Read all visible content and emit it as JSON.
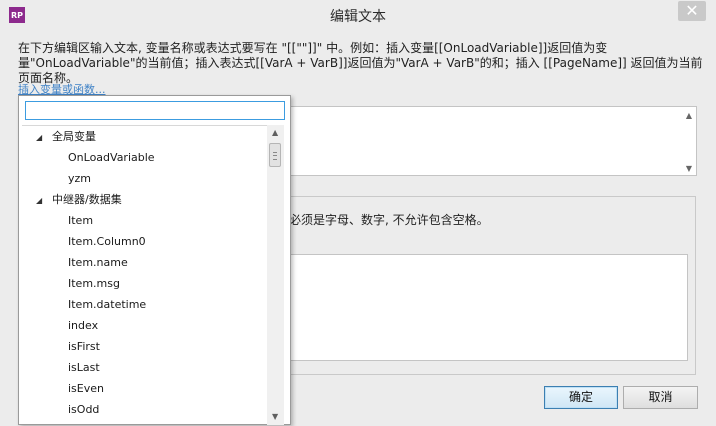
{
  "window": {
    "title": "编辑文本",
    "app_icon_text": "RP",
    "close_glyph": "✕"
  },
  "description": "在下方编辑区输入文本, 变量名称或表达式要写在 \"[[\"\"]]\" 中。例如：插入变量[[OnLoadVariable]]返回值为变量\"OnLoadVariable\"的当前值；插入表达式[[VarA + VarB]]返回值为\"VarA + VarB\"的和；插入 [[PageName]] 返回值为当前页面名称。",
  "insert_link": "插入变量或函数...",
  "group_text": "必须是字母、数字, 不允许包含空格。",
  "buttons": {
    "ok": "确定",
    "cancel": "取消"
  },
  "popup": {
    "search_value": "",
    "tree": [
      {
        "type": "group",
        "label": "全局变量"
      },
      {
        "type": "leaf",
        "label": "OnLoadVariable"
      },
      {
        "type": "leaf",
        "label": "yzm"
      },
      {
        "type": "group",
        "label": "中继器/数据集"
      },
      {
        "type": "leaf",
        "label": "Item"
      },
      {
        "type": "leaf",
        "label": "Item.Column0"
      },
      {
        "type": "leaf",
        "label": "Item.name"
      },
      {
        "type": "leaf",
        "label": "Item.msg"
      },
      {
        "type": "leaf",
        "label": "Item.datetime"
      },
      {
        "type": "leaf",
        "label": "index"
      },
      {
        "type": "leaf",
        "label": "isFirst"
      },
      {
        "type": "leaf",
        "label": "isLast"
      },
      {
        "type": "leaf",
        "label": "isEven"
      },
      {
        "type": "leaf",
        "label": "isOdd"
      }
    ],
    "expanded_caret": "◢",
    "scroll_up": "▲",
    "scroll_down": "▼"
  },
  "colors": {
    "accent": "#3c9ce0",
    "link": "#3f82c6",
    "app_icon": "#8d2a8d"
  },
  "icons": {
    "app": "axure-rp-icon",
    "close": "close-icon",
    "caret": "expanded-caret-icon"
  }
}
